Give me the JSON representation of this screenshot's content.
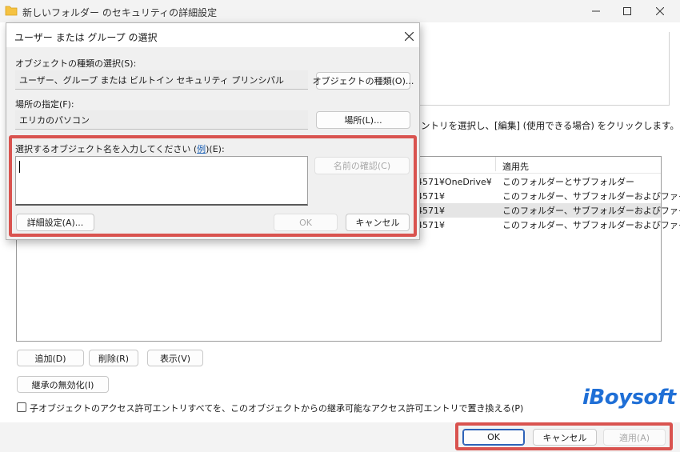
{
  "window": {
    "title": "新しいフォルダー のセキュリティの詳細設定",
    "minimize_icon": "minimize-icon",
    "maximize_icon": "maximize-icon",
    "close_icon": "close-icon"
  },
  "main": {
    "instruction_text": "ントリを選択し、[編集] (使用できる場合) をクリックします。",
    "table": {
      "header_applies_to": "適用先",
      "rows": [
        {
          "path": "4571¥OneDrive¥",
          "applies_to": "このフォルダーとサブフォルダー"
        },
        {
          "path": "4571¥",
          "applies_to": "このフォルダー、サブフォルダーおよびファイル"
        },
        {
          "path": "4571¥",
          "applies_to": "このフォルダー、サブフォルダーおよびファイル"
        },
        {
          "path": "4571¥",
          "applies_to": "このフォルダー、サブフォルダーおよびファイル"
        }
      ]
    },
    "add_label": "追加(D)",
    "remove_label": "削除(R)",
    "view_label": "表示(V)",
    "disable_inheritance_label": "継承の無効化(I)",
    "replace_checkbox_label": "子オブジェクトのアクセス許可エントリすべてを、このオブジェクトからの継承可能なアクセス許可エントリで置き換える(P)",
    "ok_label": "OK",
    "cancel_label": "キャンセル",
    "apply_label": "適用(A)"
  },
  "watermark": {
    "brand": "iBoysoft"
  },
  "dialog": {
    "title": "ユーザー または グループ の選択",
    "object_type_label": "オブジェクトの種類の選択(S):",
    "object_type_value": "ユーザー、グループ または ビルトイン セキュリティ プリンシパル",
    "object_type_button": "オブジェクトの種類(O)...",
    "location_label": "場所の指定(F):",
    "location_value": "エリカのパソコン",
    "location_button": "場所(L)...",
    "enter_names_label_prefix": "選択するオブジェクト名を入力してください (",
    "enter_names_example_link": "例",
    "enter_names_label_suffix": ")(E):",
    "enter_names_value": "",
    "check_names_button": "名前の確認(C)",
    "advanced_button": "詳細設定(A)...",
    "ok_button": "OK",
    "cancel_button": "キャンセル"
  },
  "colors": {
    "highlight": "#d9534f",
    "link": "#1a5fb4",
    "brand_blue": "#1f6fd6",
    "selected_row": "#e5e5e5"
  }
}
